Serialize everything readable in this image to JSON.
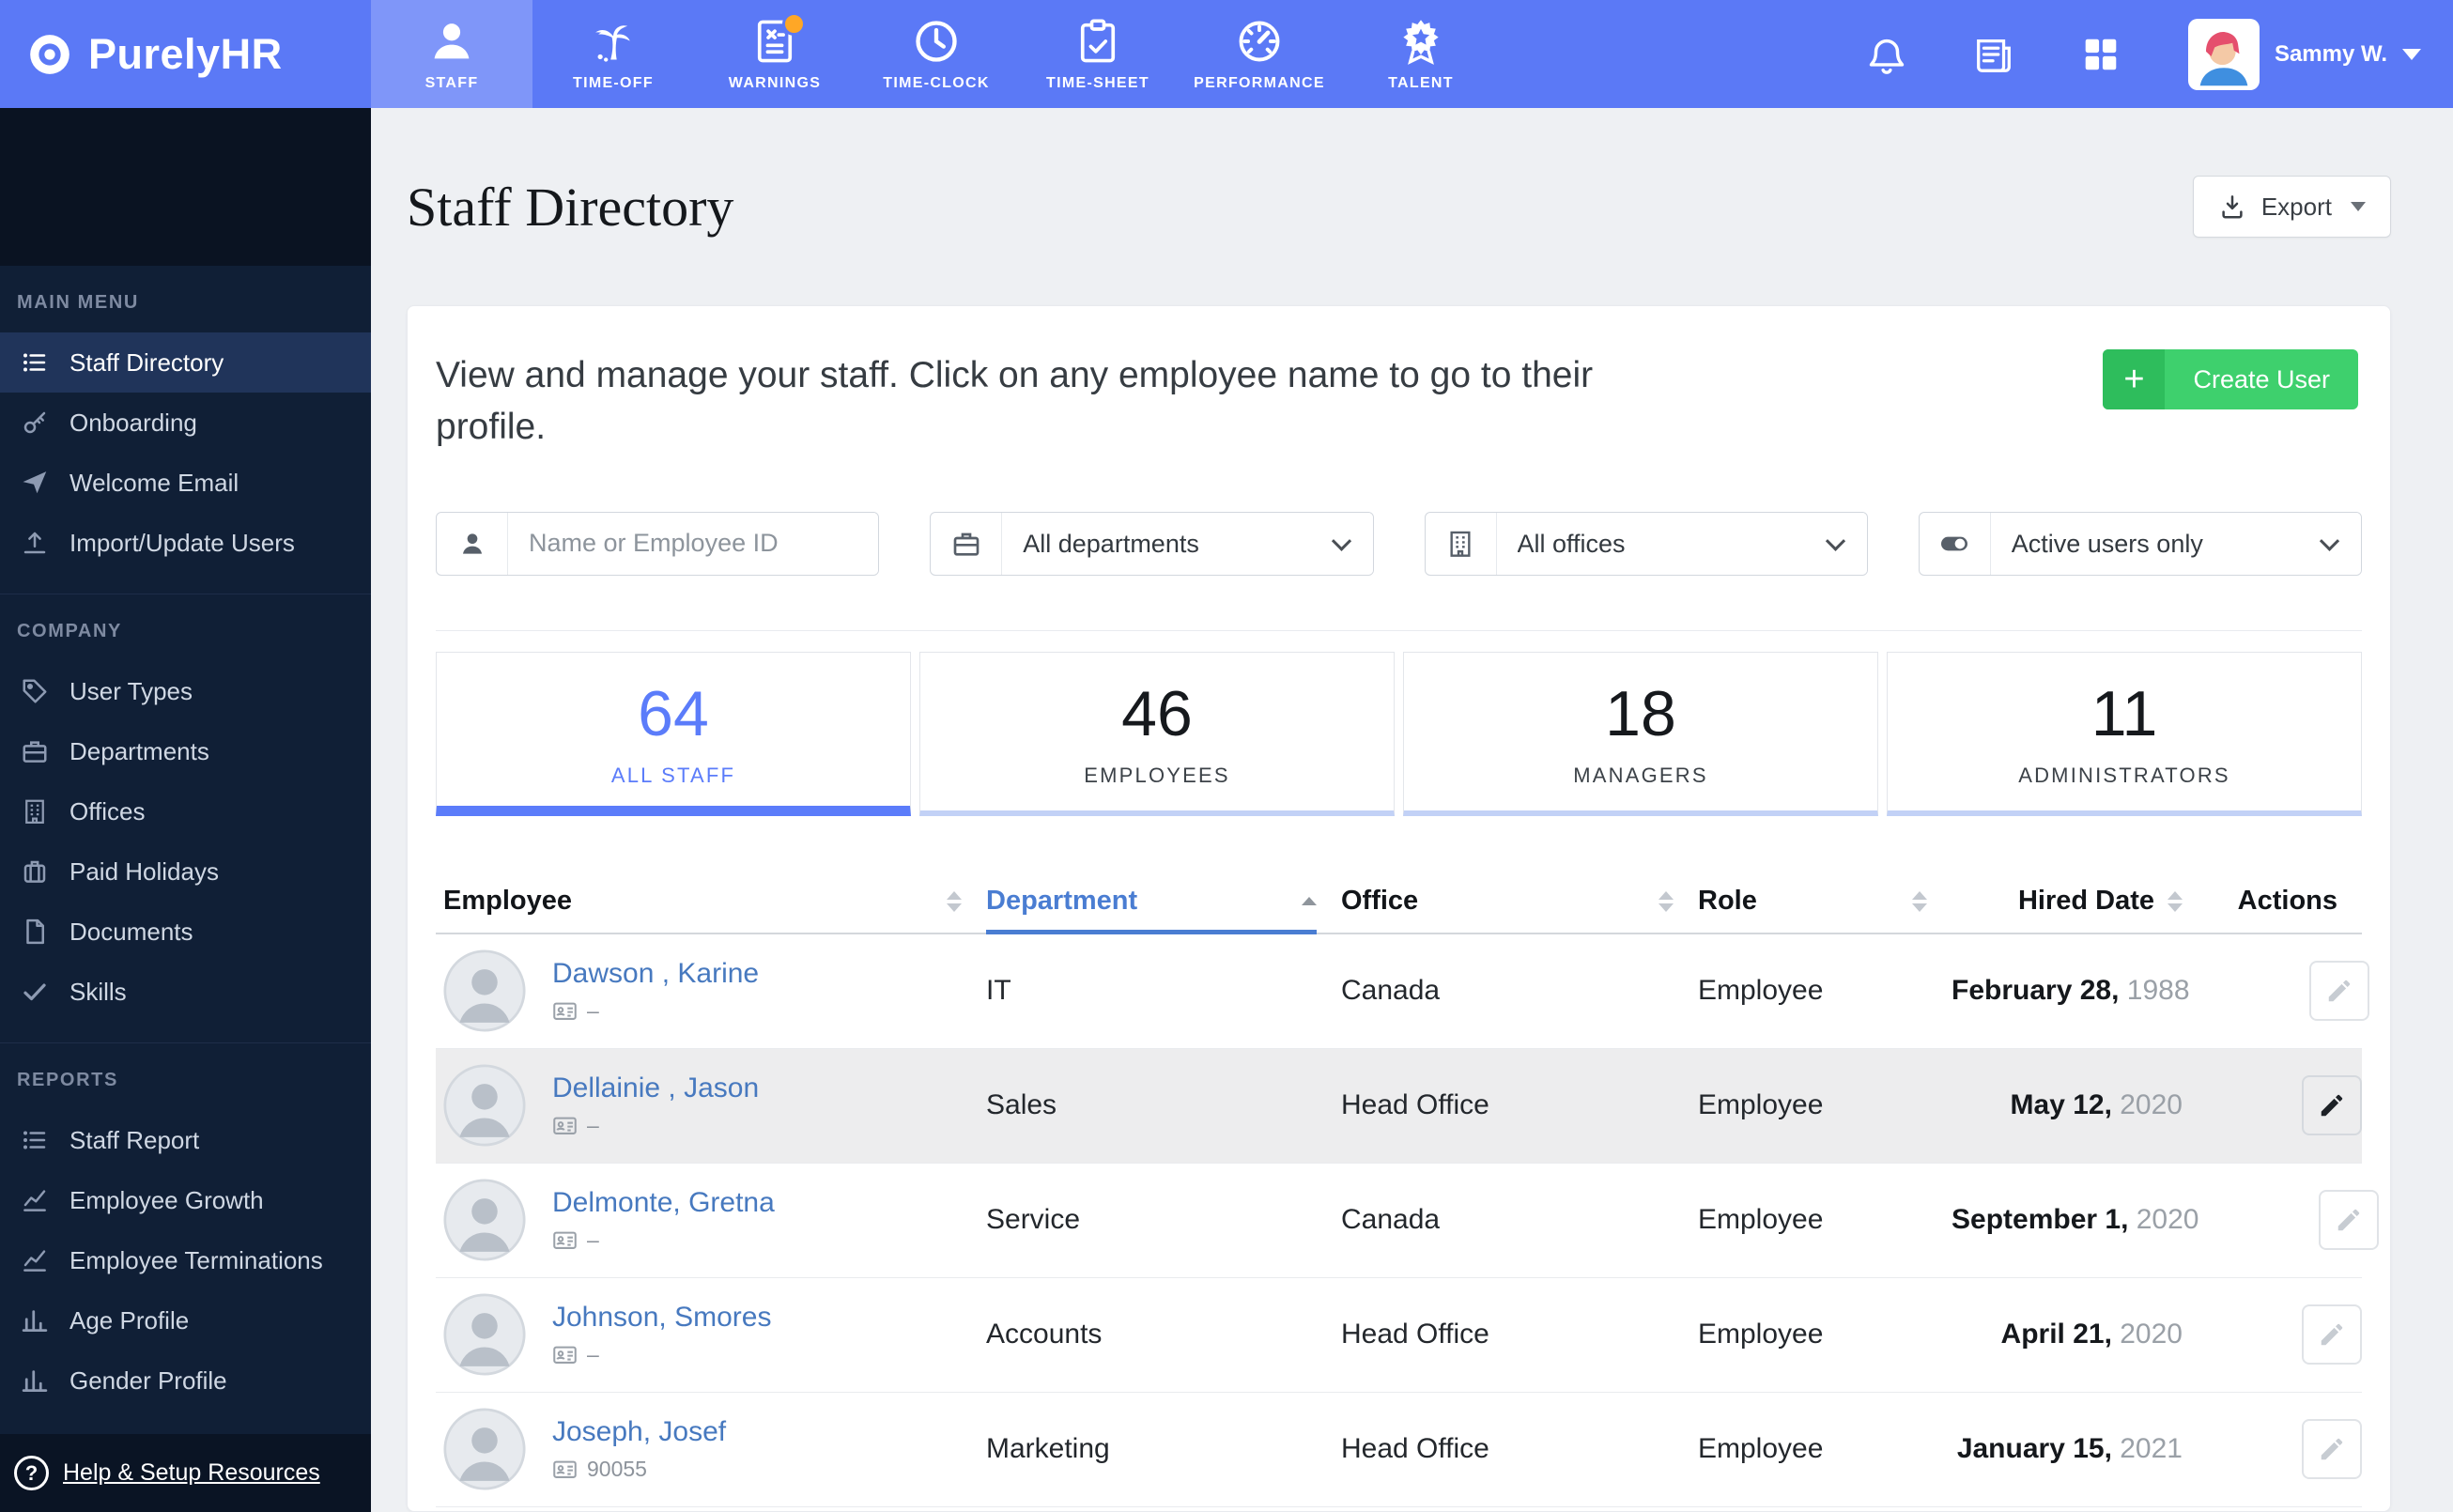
{
  "brand": {
    "name": "PurelyHR"
  },
  "navbar": {
    "tabs": [
      {
        "label": "STAFF",
        "icon": "staff",
        "active": true
      },
      {
        "label": "TIME-OFF",
        "icon": "palm-tree"
      },
      {
        "label": "WARNINGS",
        "icon": "warning-document",
        "has_badge": true
      },
      {
        "label": "TIME-CLOCK",
        "icon": "clock"
      },
      {
        "label": "TIME-SHEET",
        "icon": "clipboard-check"
      },
      {
        "label": "PERFORMANCE",
        "icon": "gauge"
      },
      {
        "label": "TALENT",
        "icon": "award-star"
      }
    ],
    "tools": [
      {
        "icon": "bell"
      },
      {
        "icon": "newspaper"
      },
      {
        "icon": "grid"
      }
    ],
    "user": {
      "name": "Sammy W."
    }
  },
  "sidebar": {
    "sections": [
      {
        "title": "MAIN MENU",
        "items": [
          {
            "label": "Staff Directory",
            "icon": "list",
            "active": true
          },
          {
            "label": "Onboarding",
            "icon": "key"
          },
          {
            "label": "Welcome Email",
            "icon": "paper-plane"
          },
          {
            "label": "Import/Update Users",
            "icon": "upload"
          }
        ]
      },
      {
        "title": "COMPANY",
        "items": [
          {
            "label": "User Types",
            "icon": "tag"
          },
          {
            "label": "Departments",
            "icon": "briefcase"
          },
          {
            "label": "Offices",
            "icon": "building"
          },
          {
            "label": "Paid Holidays",
            "icon": "suitcase"
          },
          {
            "label": "Documents",
            "icon": "document"
          },
          {
            "label": "Skills",
            "icon": "checkmark"
          }
        ]
      },
      {
        "title": "REPORTS",
        "items": [
          {
            "label": "Staff Report",
            "icon": "list"
          },
          {
            "label": "Employee Growth",
            "icon": "line-chart"
          },
          {
            "label": "Employee Terminations",
            "icon": "line-chart"
          },
          {
            "label": "Age Profile",
            "icon": "bar-chart"
          },
          {
            "label": "Gender Profile",
            "icon": "bar-chart"
          }
        ]
      }
    ],
    "help_label": "Help & Setup Resources"
  },
  "page": {
    "title": "Staff Directory",
    "export_label": "Export",
    "intro": "View and manage your staff. Click on any employee name to go to their profile.",
    "create_user_label": "Create User"
  },
  "filters": [
    {
      "type": "input",
      "icon": "person",
      "placeholder": "Name or Employee ID"
    },
    {
      "type": "select",
      "icon": "briefcase",
      "value": "All departments"
    },
    {
      "type": "select",
      "icon": "building",
      "value": "All offices"
    },
    {
      "type": "select",
      "icon": "toggle",
      "value": "Active users only"
    }
  ],
  "stats": [
    {
      "value": "64",
      "label": "ALL STAFF",
      "active": true
    },
    {
      "value": "46",
      "label": "EMPLOYEES"
    },
    {
      "value": "18",
      "label": "MANAGERS"
    },
    {
      "value": "11",
      "label": "ADMINISTRATORS"
    }
  ],
  "table": {
    "columns": [
      {
        "label": "Employee",
        "sort": "both"
      },
      {
        "label": "Department",
        "sort": "asc",
        "active": true
      },
      {
        "label": "Office",
        "sort": "both"
      },
      {
        "label": "Role",
        "sort": "both"
      },
      {
        "label": "Hired Date",
        "sort": "both",
        "align": "right"
      },
      {
        "label": "Actions",
        "align": "right"
      }
    ],
    "rows": [
      {
        "name": "Dawson , Karine",
        "id": "–",
        "department": "IT",
        "office": "Canada",
        "role": "Employee",
        "hired_date": "February 28,",
        "hired_year": "1988"
      },
      {
        "name": "Dellainie , Jason",
        "id": "–",
        "department": "Sales",
        "office": "Head Office",
        "role": "Employee",
        "hired_date": "May 12,",
        "hired_year": "2020",
        "highlighted": true
      },
      {
        "name": "Delmonte, Gretna",
        "id": "–",
        "department": "Service",
        "office": "Canada",
        "role": "Employee",
        "hired_date": "September 1,",
        "hired_year": "2020"
      },
      {
        "name": "Johnson, Smores",
        "id": "–",
        "department": "Accounts",
        "office": "Head Office",
        "role": "Employee",
        "hired_date": "April 21,",
        "hired_year": "2020"
      },
      {
        "name": "Joseph, Josef",
        "id": "90055",
        "department": "Marketing",
        "office": "Head Office",
        "role": "Employee",
        "hired_date": "January 15,",
        "hired_year": "2021"
      }
    ]
  }
}
